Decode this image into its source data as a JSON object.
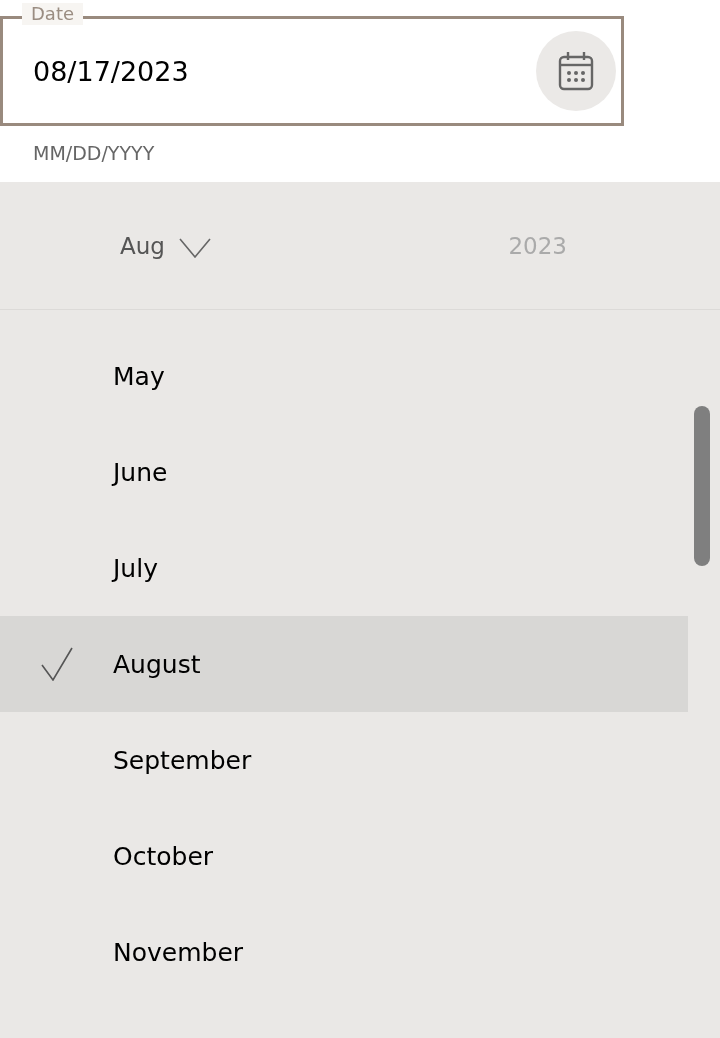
{
  "date_field": {
    "label": "Date",
    "value": "08/17/2023",
    "helper": "MM/DD/YYYY"
  },
  "picker": {
    "month_selector": {
      "label": "Aug",
      "selected": true
    },
    "year_selector": {
      "label": "2023",
      "selected": false
    },
    "months": [
      {
        "label": "May",
        "selected": false
      },
      {
        "label": "June",
        "selected": false
      },
      {
        "label": "July",
        "selected": false
      },
      {
        "label": "August",
        "selected": true
      },
      {
        "label": "September",
        "selected": false
      },
      {
        "label": "October",
        "selected": false
      },
      {
        "label": "November",
        "selected": false
      }
    ]
  }
}
